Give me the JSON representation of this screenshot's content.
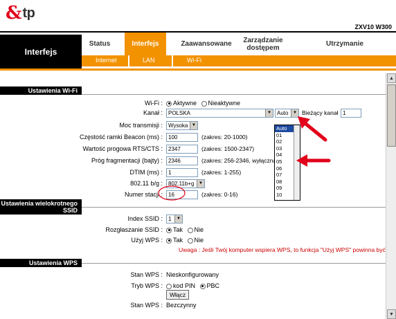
{
  "header": {
    "logo_mark": "&",
    "logo_text": "tp",
    "model": "ZXV10 W300"
  },
  "nav": {
    "section_title": "Interfejs",
    "tabs": [
      {
        "label": "Status"
      },
      {
        "label": "Interfejs"
      },
      {
        "label": "Zaawansowane"
      },
      {
        "label": "Zarządzanie dostępem"
      },
      {
        "label": "Utrzymanie"
      }
    ],
    "subtabs": [
      {
        "label": "Internet"
      },
      {
        "label": "LAN"
      },
      {
        "label": "Wi-Fi"
      }
    ]
  },
  "wifi": {
    "section_title": "Ustawienia Wi-Fi",
    "wifi_label": "Wi-Fi :",
    "wifi_on": "Aktywne",
    "wifi_off": "Nieaktywne",
    "country_label": "Kanał :",
    "country_value": "POLSKA",
    "channel_value": "Auto",
    "current_channel_label": "Bieżący kanał",
    "current_channel_value": "1",
    "power_label": "Moc transmisji :",
    "power_value": "Wysoka",
    "beacon_label": "Częstość ramki Beacon (ms) :",
    "beacon_value": "100",
    "beacon_hint": "(zakres: 20-1000)",
    "rts_label": "Wartość progowa RTS/CTS :",
    "rts_value": "2347",
    "rts_hint": "(zakres: 1500-2347)",
    "frag_label": "Próg fragmentacji (bajty) :",
    "frag_value": "2346",
    "frag_hint": "(zakres: 256-2346, wyłączna",
    "dtim_label": "DTIM (ms) :",
    "dtim_value": "1",
    "dtim_hint": "(zakres: 1-255)",
    "mode_label": "802.11 b/g :",
    "mode_value": "802.11b+g",
    "station_label": "Numer stacji :",
    "station_value": "16",
    "station_hint": "(zakres: 0-16)",
    "channel_options": [
      "Auto",
      "01",
      "02",
      "03",
      "04",
      "05",
      "06",
      "07",
      "08",
      "09",
      "10"
    ]
  },
  "multi_ssid": {
    "section_title": "Ustawienia wielokrotnego SSID",
    "index_label": "Index SSID :",
    "index_value": "1",
    "broadcast_label": "Rozgłaszanie SSID :",
    "yes": "Tak",
    "no": "Nie",
    "wps_label": "Użyj WPS :",
    "warning": "Uwaga : Jeśli Twój komputer wspiera WPS, to funkcja \"Użyj WPS\" powinna być włączona."
  },
  "wps": {
    "section_title": "Ustawienia WPS",
    "state_label": "Stan WPS :",
    "state_value": "Nieskonfigurowany",
    "mode_label": "Tryb WPS :",
    "mode_pin": "kod PIN",
    "mode_pbc": "PBC",
    "enable_button": "Włącz",
    "status_label": "Stan WPS :",
    "status_value": "Bezczynny"
  },
  "colors": {
    "accent": "#f39200",
    "warning": "#cc0000",
    "annotation": "#e2001a"
  }
}
